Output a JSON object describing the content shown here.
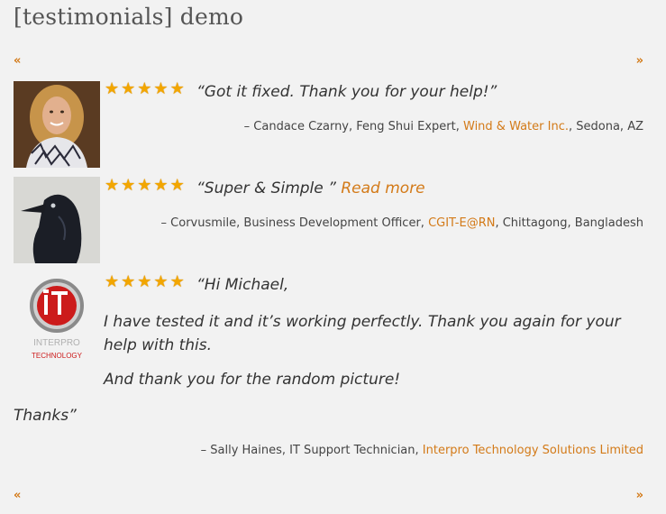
{
  "page": {
    "title": "[testimonials] demo"
  },
  "nav": {
    "prev": "«",
    "next": "»"
  },
  "testimonials": [
    {
      "stars": 5,
      "quote": "“Got it fixed. Thank you for your help!”",
      "author": {
        "prefix": "– Candace Czarny, Feng Shui Expert, ",
        "org": "Wind & Water Inc.",
        "suffix": ", Sedona, AZ"
      }
    },
    {
      "stars": 5,
      "quote": "“Super & Simple ”",
      "read_more": "Read more",
      "author": {
        "prefix": "– Corvusmile, Business Development Officer, ",
        "org": "CGIT-E@RN",
        "suffix": ", Chittagong, Bangladesh"
      }
    },
    {
      "stars": 5,
      "quote_line1": "“Hi Michael,",
      "quote_para1": "I have tested it and it’s working perfectly. Thank you again for your help with this.",
      "quote_para2": "And thank you for the random picture!",
      "quote_end": "Thanks”",
      "logo_text": "INTERPRO",
      "logo_sub": "TECHNOLOGY",
      "author": {
        "prefix": "– Sally Haines, IT Support Technician, ",
        "org": "Interpro Technology Solutions Limited",
        "suffix": ""
      }
    }
  ],
  "colors": {
    "accent": "#d37a18",
    "star": "#f2a600",
    "background": "#f2f2f2"
  }
}
